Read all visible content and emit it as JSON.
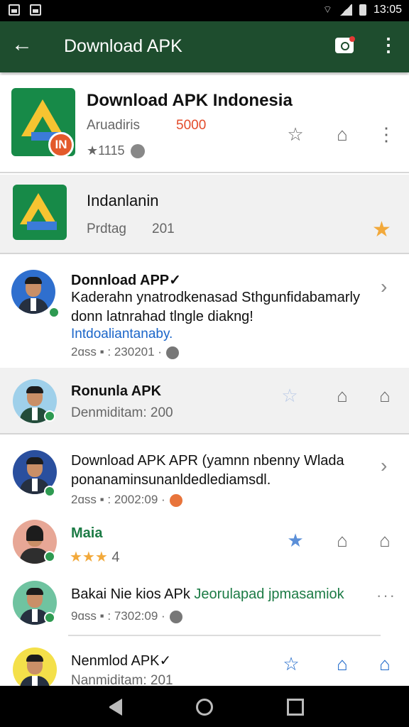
{
  "status": {
    "time": "13:05"
  },
  "appbar": {
    "title": "Download APK"
  },
  "card1": {
    "title": "Download APK Indonesia",
    "subtitle": "Aruadiris",
    "count": "5000",
    "rating": "★1115",
    "badge": "IN"
  },
  "card2": {
    "title": "Indanlanin",
    "subtitle": "Prdtag",
    "count": "201"
  },
  "items": [
    {
      "title": "Donnload APP✓",
      "body1": "Kaderahn ynatrodkenasad Sthgunfidabamarly",
      "body2": "donn latnrahad tlngle diakng!",
      "link": "Intdoaliantanaby.",
      "meta": "2ɑss  ▪ :  230201 ·"
    },
    {
      "title": "Ronunla APK",
      "meta": "Denmiditam: 200"
    },
    {
      "title": "Download APK APR (yamnn nbenny Wlada",
      "body1": "ponanaminsunanldedlediamsdl.",
      "meta": "2ɑss  ▪ :  2002:09 ·"
    },
    {
      "title": "Maia",
      "stars": "★★★",
      "stars_count": "4"
    },
    {
      "title": "Bakai Nie kios APk",
      "title_green": "Jeorulapad jpmasamiok",
      "meta": "9ɑss  ▪ :  7302:09 ·"
    },
    {
      "title": "Nenmlod APK✓",
      "meta": "Nanmiditam: 201"
    }
  ],
  "icons": {
    "share": "☆",
    "bookmark": "⌂",
    "kebab": "⋮",
    "chevron": "›",
    "more": "···"
  },
  "colors": {
    "appbar": "#1e4d2e",
    "accent_blue": "#1b66c9",
    "accent_green": "#2e9a51"
  }
}
